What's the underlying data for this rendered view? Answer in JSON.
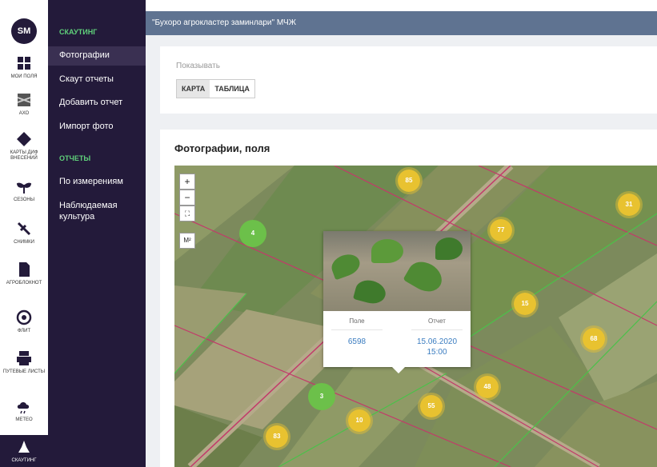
{
  "rail": {
    "logo_text": "SM",
    "items": [
      {
        "label": "МОИ ПОЛЯ",
        "icon": "fields-icon"
      },
      {
        "label": "АХО",
        "icon": "aho-icon"
      },
      {
        "label": "КАРТЫ ДИФ ВНЕСЕНИЙ",
        "icon": "diff-maps-icon"
      },
      {
        "label": "СЕЗОНЫ",
        "icon": "seasons-icon"
      },
      {
        "label": "СНИМКИ",
        "icon": "satellite-icon"
      },
      {
        "label": "АГРОБЛОКНОТ",
        "icon": "agronotebook-icon"
      },
      {
        "label": "ФЛИТ",
        "icon": "fleet-icon"
      },
      {
        "label": "ПУТЕВЫЕ ЛИСТЫ",
        "icon": "waybills-icon"
      },
      {
        "label": "МЕТЕО",
        "icon": "weather-icon"
      },
      {
        "label": "СКАУТИНГ",
        "icon": "scouting-icon"
      }
    ]
  },
  "menu": {
    "section_scouting": "СКАУТИНГ",
    "scouting_items": [
      "Фотографии",
      "Скаут отчеты",
      "Добавить отчет",
      "Импорт фото"
    ],
    "section_reports": "ОТЧЕТЫ",
    "report_items": [
      "По измерениям",
      "Наблюдаемая культура"
    ]
  },
  "header": {
    "title": "\"Бухоро агрокластер заминлари\" МЧЖ"
  },
  "filters": {
    "show_label": "Показывать",
    "tabs": [
      "КАРТА",
      "ТАБЛИЦА"
    ],
    "selected": "КАРТА"
  },
  "page": {
    "section_title": "Фотографии, поля"
  },
  "map": {
    "controls": {
      "zoom_in": "+",
      "zoom_out": "−",
      "fullscreen": "⛶",
      "measure": "M²"
    },
    "clusters": [
      "85",
      "4",
      "77",
      "31",
      "15",
      "68",
      "3",
      "10",
      "55",
      "48",
      "83"
    ],
    "popup": {
      "field_header": "Поле",
      "field_value": "6598",
      "report_header": "Отчет",
      "report_date": "15.06.2020",
      "report_time": "15:00"
    }
  },
  "colors": {
    "menu_bg": "#231a3a",
    "accent_green": "#5fd07a",
    "topbar": "#5f7391",
    "cluster_yellow": "#e8c230",
    "cluster_green": "#6cc04a"
  }
}
